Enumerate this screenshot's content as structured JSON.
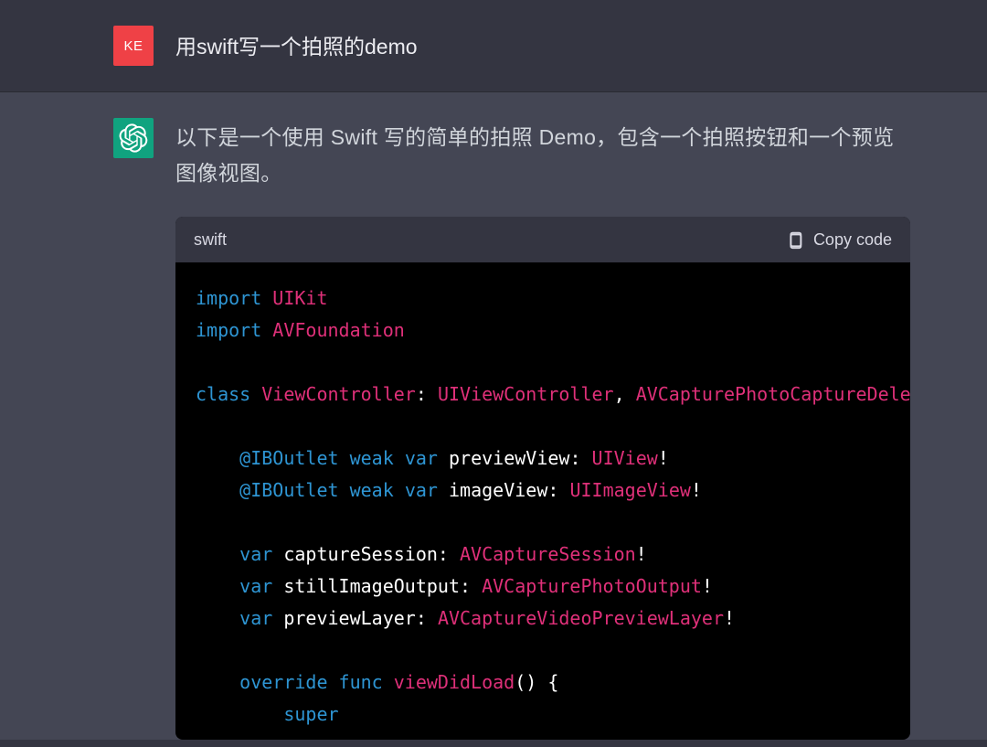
{
  "user": {
    "avatar_initials": "KE",
    "message": "用swift写一个拍照的demo"
  },
  "assistant": {
    "intro": "以下是一个使用 Swift 写的简单的拍照 Demo，包含一个拍照按钮和一个预览图像视图。"
  },
  "code": {
    "language": "swift",
    "copy_label": "Copy code",
    "tokens": {
      "import1_kw": "import",
      "import1_mod": "UIKit",
      "import2_kw": "import",
      "import2_mod": "AVFoundation",
      "class_kw": "class",
      "class_name": "ViewController",
      "class_colon_sp": ": ",
      "class_super": "UIViewController",
      "class_comma": ", ",
      "class_proto": "AVCapturePhotoCaptureDele",
      "outlet1_attr": "@IBOutlet",
      "outlet1_weak": "weak",
      "outlet1_var": "var",
      "outlet1_name": "previewView",
      "outlet1_type": "UIView",
      "outlet1_bang": "!",
      "outlet2_attr": "@IBOutlet",
      "outlet2_weak": "weak",
      "outlet2_var": "var",
      "outlet2_name": "imageView",
      "outlet2_type": "UIImageView",
      "outlet2_bang": "!",
      "var1_kw": "var",
      "var1_name": "captureSession",
      "var1_type": "AVCaptureSession",
      "var1_bang": "!",
      "var2_kw": "var",
      "var2_name": "stillImageOutput",
      "var2_type": "AVCapturePhotoOutput",
      "var2_bang": "!",
      "var3_kw": "var",
      "var3_name": "previewLayer",
      "var3_type": "AVCaptureVideoPreviewLayer",
      "var3_bang": "!",
      "override_kw": "override",
      "func_kw": "func",
      "func_name": "viewDidLoad",
      "func_parens": "()",
      "func_brace": " {",
      "super_kw": "super"
    }
  }
}
